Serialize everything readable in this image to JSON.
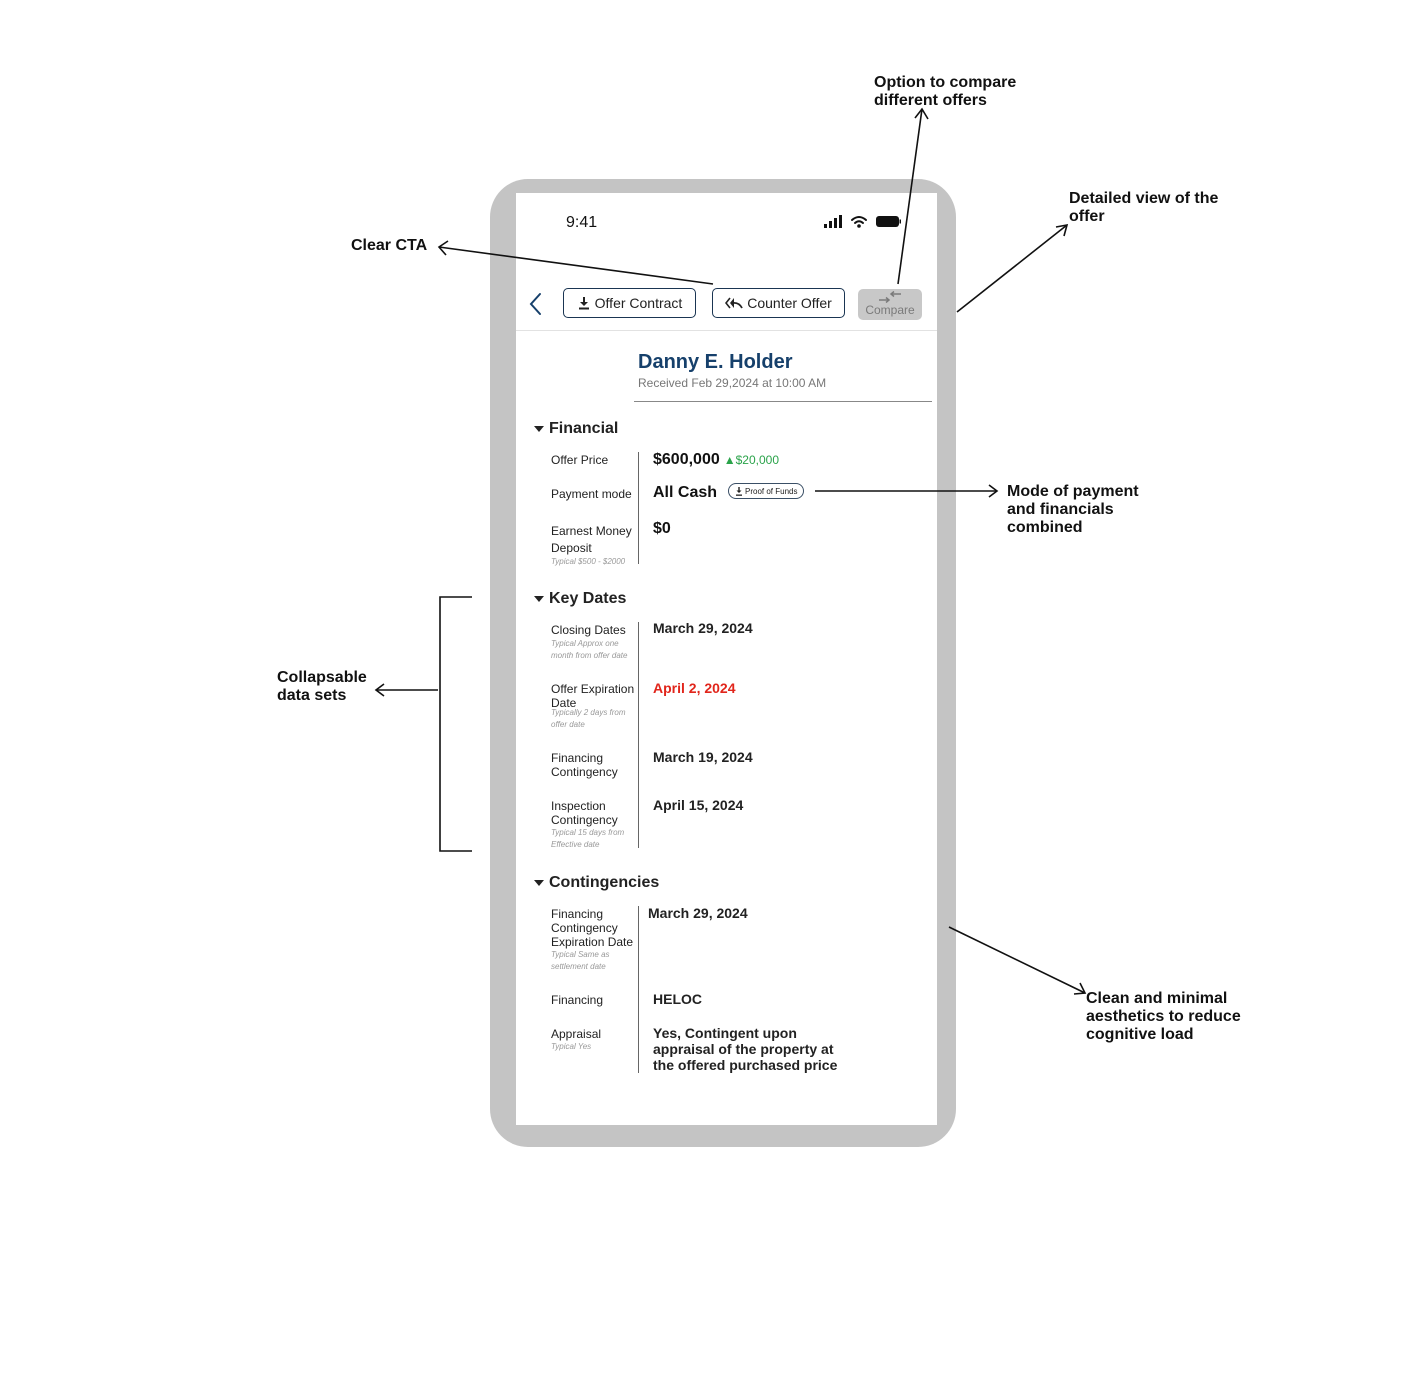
{
  "annotations": {
    "compare": "Option to compare\ndifferent offers",
    "detailed": "Detailed view of the\noffer",
    "cta": "Clear CTA",
    "payment": "Mode of payment\nand financials\ncombined",
    "collapsable": "Collapsable\ndata sets",
    "clean": "Clean and minimal\naesthetics to reduce\ncognitive load"
  },
  "status_bar": {
    "time": "9:41"
  },
  "toolbar": {
    "offer_contract": "Offer Contract",
    "counter_offer": "Counter Offer",
    "compare": "Compare"
  },
  "offer": {
    "buyer_name": "Danny E. Holder",
    "received": "Received Feb 29,2024 at 10:00 AM"
  },
  "financial": {
    "title": "Financial",
    "offer_price_label": "Offer Price",
    "offer_price": "$600,000",
    "offer_price_delta": "$20,000",
    "payment_mode_label": "Payment mode",
    "payment_mode": "All Cash",
    "proof_of_funds": "Proof of Funds",
    "earnest_label": "Earnest Money\nDeposit",
    "earnest_hint": "Typical $500 - $2000",
    "earnest_value": "$0"
  },
  "key_dates": {
    "title": "Key Dates",
    "closing_label": "Closing Dates",
    "closing_hint": "Typical Approx one\nmonth from offer date",
    "closing_value": "March 29, 2024",
    "expiration_label": "Offer Expiration\nDate",
    "expiration_hint": "Typically 2 days from\noffer date",
    "expiration_value": "April 2, 2024",
    "financing_label": "Financing\nContingency",
    "financing_value": "March 19, 2024",
    "inspection_label": "Inspection\nContingency",
    "inspection_hint": "Typical 15 days from\nEffective date",
    "inspection_value": "April 15, 2024"
  },
  "contingencies": {
    "title": "Contingencies",
    "fin_exp_label": "Financing\nContingency\nExpiration Date",
    "fin_exp_hint": "Typical Same as\nsettlement date",
    "fin_exp_value": "March 29, 2024",
    "financing_label": "Financing",
    "financing_value": "HELOC",
    "appraisal_label": "Appraisal",
    "appraisal_hint": "Typical Yes",
    "appraisal_value": "Yes, Contingent upon\nappraisal of the property at\nthe offered purchased price"
  },
  "colors": {
    "accent_navy": "#16406b",
    "button_border": "#1a3552",
    "warning_red": "#e1251b",
    "increase_green": "#2aa34a",
    "phone_frame": "#c4c4c4"
  }
}
